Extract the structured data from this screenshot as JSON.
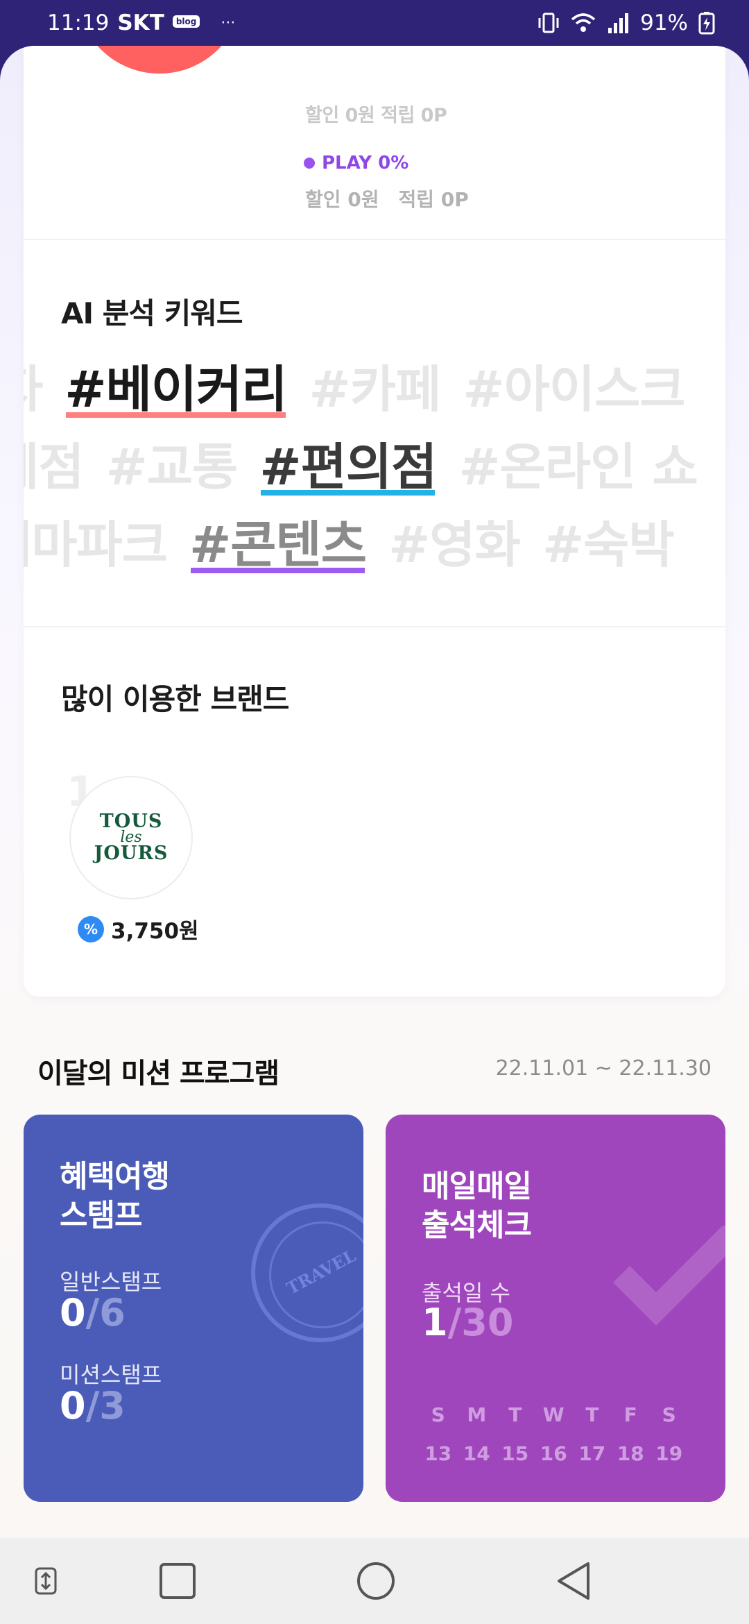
{
  "status_bar": {
    "time": "11:19",
    "carrier": "SKT",
    "badge": "blog",
    "more": "···",
    "battery": "91%"
  },
  "top_stats": {
    "faded_line": "할인 0원   적립 0P",
    "play_label": "PLAY 0%",
    "play_discount": "할인 0원",
    "play_points": "적립 0P",
    "donut_color": "#ff6060",
    "play_color": "#8f48e6"
  },
  "ai_keywords": {
    "title": "AI 분석 키워드",
    "row1": [
      {
        "text": "자",
        "style": "faded"
      },
      {
        "text": "#베이커리",
        "style": "highlight",
        "underline": "#ff7f7f"
      },
      {
        "text": "#카페",
        "style": "faded"
      },
      {
        "text": "#아이스크",
        "style": "faded"
      }
    ],
    "row2": [
      {
        "text": "세점",
        "style": "faded"
      },
      {
        "text": "#교통",
        "style": "faded"
      },
      {
        "text": "#편의점",
        "style": "highlight2",
        "underline": "#22b2e8"
      },
      {
        "text": "#온라인 쇼",
        "style": "faded"
      }
    ],
    "row3": [
      {
        "text": "테마파크",
        "style": "faded"
      },
      {
        "text": "#콘텐츠",
        "style": "highlight3",
        "underline": "#9d5cf0"
      },
      {
        "text": "#영화",
        "style": "faded"
      },
      {
        "text": "#숙박",
        "style": "faded"
      }
    ]
  },
  "brands": {
    "title": "많이 이용한 브랜드",
    "items": [
      {
        "rank": "1",
        "logo_line1": "TOUS",
        "logo_line2": "les",
        "logo_line3": "JOURS",
        "badge_icon": "%",
        "amount": "3,750원"
      }
    ]
  },
  "missions": {
    "title": "이달의 미션 프로그램",
    "period": "22.11.01 ~ 22.11.30",
    "stamp_card": {
      "title_line1": "혜택여행",
      "title_line2": "스탬프",
      "general_label": "일반스탬프",
      "general_value": "0",
      "general_total": "/6",
      "mission_label": "미션스탬프",
      "mission_value": "0",
      "mission_total": "/3",
      "stamp_text": "TRAVEL",
      "color": "#4a5cb8"
    },
    "attendance_card": {
      "title_line1": "매일매일",
      "title_line2": "출석체크",
      "days_label": "출석일 수",
      "days_value": "1",
      "days_total": "/30",
      "weekdays": [
        "S",
        "M",
        "T",
        "W",
        "T",
        "F",
        "S"
      ],
      "dates": [
        "13",
        "14",
        "15",
        "16",
        "17",
        "18",
        "19"
      ],
      "color": "#a046bd"
    }
  },
  "nav": {
    "icons": [
      "rotate-icon",
      "recents-icon",
      "home-icon",
      "back-icon"
    ]
  }
}
